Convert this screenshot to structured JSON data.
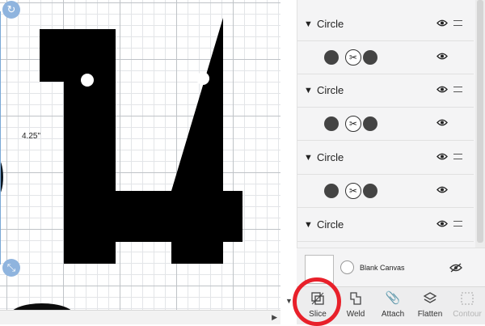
{
  "canvas": {
    "dimension_label": "4.25\""
  },
  "layers": [
    {
      "group_name": "Circle"
    },
    {
      "group_name": "Circle"
    },
    {
      "group_name": "Circle"
    },
    {
      "group_name": "Circle"
    }
  ],
  "blank_canvas": {
    "label": "Blank Canvas"
  },
  "toolbar": {
    "slice": "Slice",
    "weld": "Weld",
    "attach": "Attach",
    "flatten": "Flatten",
    "contour": "Contour"
  },
  "colors": {
    "annotation_circle": "#e8202a",
    "selection_handle": "#8fb4de"
  }
}
